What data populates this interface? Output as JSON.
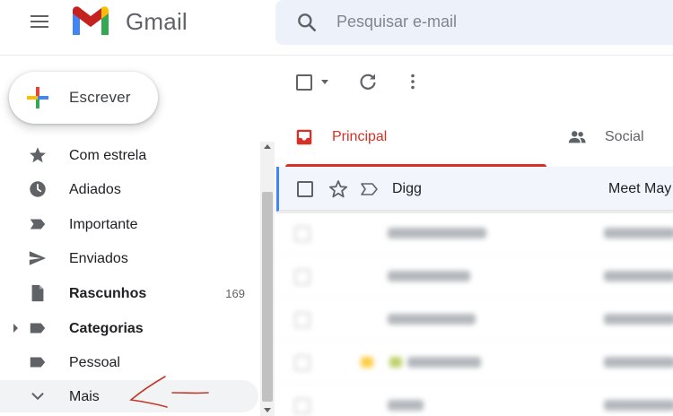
{
  "app": {
    "logo_text": "Gmail"
  },
  "search": {
    "placeholder": "Pesquisar e-mail"
  },
  "compose": {
    "label": "Escrever"
  },
  "sidebar": {
    "items": [
      {
        "label": "Com estrela",
        "icon": "star-icon"
      },
      {
        "label": "Adiados",
        "icon": "clock-icon"
      },
      {
        "label": "Importante",
        "icon": "label-important-icon"
      },
      {
        "label": "Enviados",
        "icon": "send-icon"
      },
      {
        "label": "Rascunhos",
        "icon": "draft-icon",
        "count": "169",
        "bold": true
      },
      {
        "label": "Categorias",
        "icon": "label-icon",
        "bold": true,
        "expandable": true
      },
      {
        "label": "Pessoal",
        "icon": "label-icon"
      },
      {
        "label": "Mais",
        "icon": "chevron-down-icon"
      }
    ]
  },
  "tabs": [
    {
      "label": "Principal",
      "icon": "inbox-icon",
      "active": true,
      "color": "#d93025"
    },
    {
      "label": "Social",
      "icon": "people-icon",
      "active": false
    }
  ],
  "emails": [
    {
      "sender": "Digg",
      "subject": "Meet May"
    }
  ],
  "colors": {
    "accent_red": "#d93025",
    "selected_row_border": "#4285f4",
    "annotation": "#c0392b"
  }
}
